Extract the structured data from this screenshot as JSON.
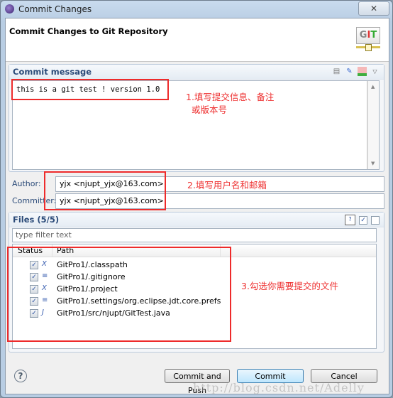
{
  "window": {
    "title": "Commit Changes",
    "close_glyph": "✕"
  },
  "header": {
    "title": "Commit Changes to Git Repository",
    "logo_text": [
      "G",
      "I",
      "T"
    ]
  },
  "commit_message": {
    "title": "Commit message",
    "value": "this is a git test ! version 1.0",
    "toolbar_icons": [
      "previous-messages-icon",
      "sign-off-icon",
      "change-id-icon",
      "view-menu-icon"
    ]
  },
  "author": {
    "label": "Author:",
    "value": "yjx <njupt_yjx@163.com>"
  },
  "committer": {
    "label": "Committer:",
    "value": "yjx <njupt_yjx@163.com>"
  },
  "files": {
    "title": "Files (5/5)",
    "filter_placeholder": "type filter text",
    "columns": [
      "Status",
      "Path"
    ],
    "rows": [
      {
        "checked": true,
        "icon": "xml-file-icon",
        "icon_glyph": "X",
        "path": "GitPro1/.classpath"
      },
      {
        "checked": true,
        "icon": "text-file-icon",
        "icon_glyph": "≡",
        "path": "GitPro1/.gitignore"
      },
      {
        "checked": true,
        "icon": "xml-file-icon",
        "icon_glyph": "X",
        "path": "GitPro1/.project"
      },
      {
        "checked": true,
        "icon": "text-file-icon",
        "icon_glyph": "≡",
        "path": "GitPro1/.settings/org.eclipse.jdt.core.prefs"
      },
      {
        "checked": true,
        "icon": "java-file-icon",
        "icon_glyph": "J",
        "path": "GitPro1/src/njupt/GitTest.java"
      }
    ]
  },
  "buttons": {
    "help": "?",
    "commit_and_push": "Commit and Push",
    "commit": "Commit",
    "cancel": "Cancel"
  },
  "annotations": {
    "step1_line1": "1.填写提交信息、备注",
    "step1_line2": "或版本号",
    "step2": "2.填写用户名和邮箱",
    "step3": "3.勾选你需要提交的文件",
    "accent_color": "#ee2b2b"
  },
  "watermark": "http://blog.csdn.net/Adelly"
}
